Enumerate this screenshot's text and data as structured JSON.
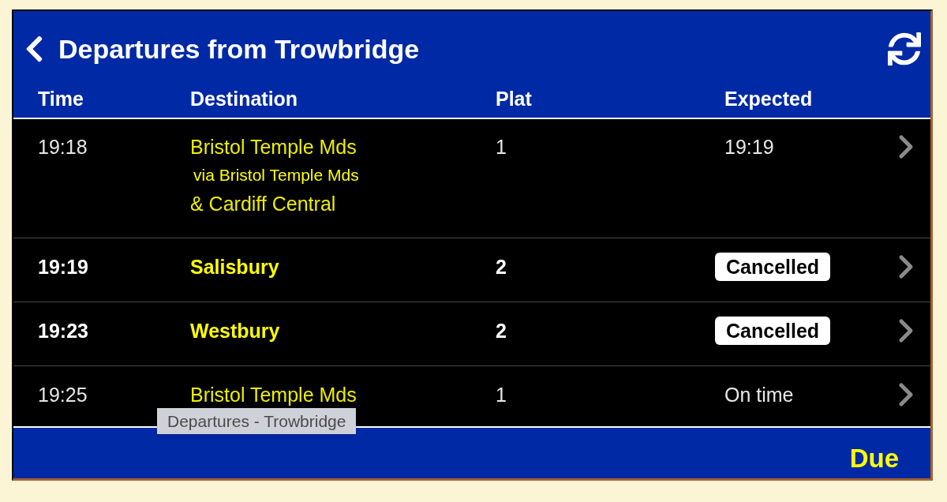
{
  "header": {
    "title": "Departures from Trowbridge"
  },
  "table": {
    "columns": [
      "Time",
      "Destination",
      "Plat",
      "Expected"
    ],
    "rows": [
      {
        "time": "19:18",
        "destination": [
          {
            "kind": "main",
            "text": "Bristol Temple Mds"
          },
          {
            "kind": "via",
            "text": "via Bristol Temple Mds"
          },
          {
            "kind": "main",
            "text": "& Cardiff Central"
          }
        ],
        "platform": "1",
        "expected": {
          "kind": "text",
          "text": "19:19"
        }
      },
      {
        "time": "19:19",
        "destination": [
          {
            "kind": "main",
            "text": "Salisbury"
          }
        ],
        "platform": "2",
        "expected": {
          "kind": "badge",
          "text": "Cancelled"
        }
      },
      {
        "time": "19:23",
        "destination": [
          {
            "kind": "main",
            "text": "Westbury"
          }
        ],
        "platform": "2",
        "expected": {
          "kind": "badge",
          "text": "Cancelled"
        }
      },
      {
        "time": "19:25",
        "destination": [
          {
            "kind": "main",
            "text": "Bristol Temple Mds"
          }
        ],
        "platform": "1",
        "expected": {
          "kind": "text",
          "text": "On time"
        }
      }
    ]
  },
  "tooltip": "Departures - Trowbridge",
  "footer": {
    "label": "Due"
  }
}
